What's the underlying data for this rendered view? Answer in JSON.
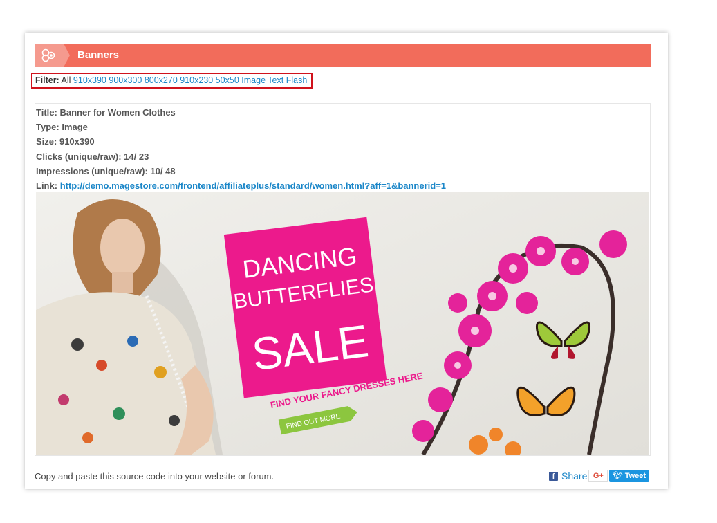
{
  "panel": {
    "title": "Banners",
    "header_color": "#f26c5b"
  },
  "filter": {
    "label": "Filter:",
    "active": "All",
    "options": [
      "910x390",
      "900x300",
      "800x270",
      "910x230",
      "50x50",
      "Image",
      "Text",
      "Flash"
    ],
    "highlight_color": "#d0121c"
  },
  "banner_item": {
    "title_label": "Title:",
    "title": "Banner for Women Clothes",
    "type_label": "Type:",
    "type": "Image",
    "size_label": "Size:",
    "size": "910x390",
    "clicks_label": "Clicks (unique/raw):",
    "clicks": "14/ 23",
    "impressions_label": "Impressions (unique/raw):",
    "impressions": "10/ 48",
    "link_label": "Link:",
    "link": "http://demo.magestore.com/frontend/affiliateplus/standard/women.html?aff=1&bannerid=1"
  },
  "banner_image": {
    "line1": "DANCING",
    "line2": "BUTTERFLIES",
    "line3": "SALE",
    "tagline": "FIND YOUR FANCY DRESSES HERE",
    "cta": "FIND OUT MORE",
    "accent": "#ec1a8c",
    "cta_color": "#8cc63f"
  },
  "footer": {
    "instructions": "Copy and paste this source code into your website or forum.",
    "share_label": "Share",
    "gplus_label": "G+",
    "tweet_label": "Tweet"
  }
}
